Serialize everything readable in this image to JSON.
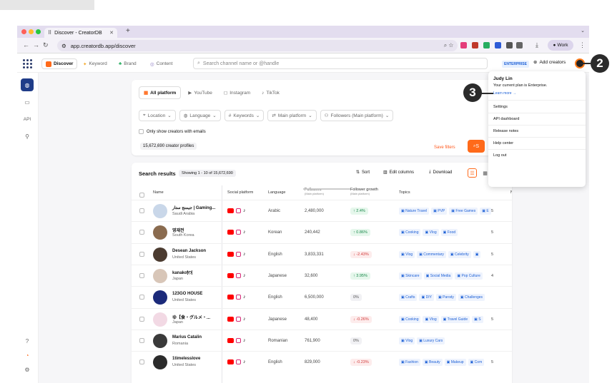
{
  "browser": {
    "tab_title": "Discover - CreatorDB",
    "url": "app.creatordb.app/discover",
    "profile_label": "Work"
  },
  "header": {
    "nav": [
      "Discover",
      "Keyword",
      "Brand",
      "Content"
    ],
    "search_placeholder": "Search channel name or @handle",
    "plan_badge": "ENTERPRISE",
    "add_creators": "Add creators"
  },
  "sidebar": {
    "items": [
      "globe-icon",
      "folder-icon",
      "API",
      "user-search-icon"
    ],
    "api_label": "API"
  },
  "filters": {
    "platform_tabs": [
      "All platform",
      "YouTube",
      "Instagram",
      "TikTok"
    ],
    "dropdowns": [
      "Location",
      "Language",
      "Keywords",
      "Main platform",
      "Followers (Main platform)"
    ],
    "email_only": "Only show creators with emails",
    "profiles_count": "15,672,690 creator profiles",
    "save_filters": "Save filters",
    "search_button": "S"
  },
  "results": {
    "title": "Search results",
    "showing": "Showing 1 - 10 of 15,672,690",
    "sort": "Sort",
    "edit_columns": "Edit columns",
    "download": "Download",
    "columns": {
      "name": "Name",
      "social": "Social platform",
      "language": "Language",
      "followers": "Followers",
      "followers_sub": "(Main platform)",
      "growth": "Follower growth",
      "growth_sub": "(Main platform)",
      "topics": "Topics",
      "n": "N"
    },
    "rows": [
      {
        "name": "جيمنج ستار | Gaming...",
        "country": "Saudi Arabia",
        "language": "Arabic",
        "followers": "2,480,000",
        "growth": "↑ 2.4%",
        "trend": "pos",
        "topics": [
          "Nature Travel",
          "PVP",
          "Free Games",
          "E"
        ],
        "n": "5",
        "color": "#c9d7e9"
      },
      {
        "name": "영재전",
        "country": "South Korea",
        "language": "Korean",
        "followers": "240,442",
        "growth": "↑ 0.86%",
        "trend": "pos",
        "topics": [
          "Cooking",
          "Vlog",
          "Food"
        ],
        "n": "5",
        "color": "#8a6b4f"
      },
      {
        "name": "Desean Jackson",
        "country": "United States",
        "language": "English",
        "followers": "3,833,331",
        "growth": "↓ -2.43%",
        "trend": "neg",
        "topics": [
          "Vlog",
          "Commentary",
          "Celebrity",
          ""
        ],
        "n": "5",
        "color": "#4b3b30"
      },
      {
        "name": "kanako🍽",
        "country": "Japan",
        "language": "Japanese",
        "followers": "32,600",
        "growth": "↑ 3.95%",
        "trend": "pos",
        "topics": [
          "Skincare",
          "Social Media",
          "Pop Culture"
        ],
        "n": "4",
        "color": "#d8c6b8"
      },
      {
        "name": "123GO HOUSE",
        "country": "United States",
        "language": "English",
        "followers": "6,500,000",
        "growth": "0%",
        "trend": "zero",
        "topics": [
          "Crafts",
          "DIY",
          "Parody",
          "Challenges"
        ],
        "n": "",
        "color": "#1b2a7a"
      },
      {
        "name": "ゆ【食・グルメ・...",
        "country": "Japan",
        "language": "Japanese",
        "followers": "48,400",
        "growth": "↓ -0.26%",
        "trend": "neg",
        "topics": [
          "Cooking",
          "Vlog",
          "Travel Guide",
          "S"
        ],
        "n": "5",
        "color": "#f2d9e4"
      },
      {
        "name": "Marius Catalin",
        "country": "Romania",
        "language": "Romanian",
        "followers": "761,900",
        "growth": "0%",
        "trend": "zero",
        "topics": [
          "Vlog",
          "Luxury Cars"
        ],
        "n": "",
        "color": "#3a3a3a"
      },
      {
        "name": "1timelesslove",
        "country": "United States",
        "language": "English",
        "followers": "829,000",
        "growth": "↓ -0.23%",
        "trend": "neg",
        "topics": [
          "Fashion",
          "Beauty",
          "Makeup",
          "Com"
        ],
        "n": "5",
        "color": "#2b2b2b"
      }
    ]
  },
  "dropdown": {
    "name": "Judy Lin",
    "plan": "Your current plan is Enterprise.",
    "learn_more": "Learn more →",
    "items": [
      "Settings",
      "API dashboard",
      "Release notes",
      "Help center",
      "Log out"
    ]
  },
  "callouts": [
    "2",
    "3"
  ],
  "colors": {
    "accent": "#ff6a1a",
    "navy": "#1f3c88",
    "link": "#1b5fd6"
  }
}
